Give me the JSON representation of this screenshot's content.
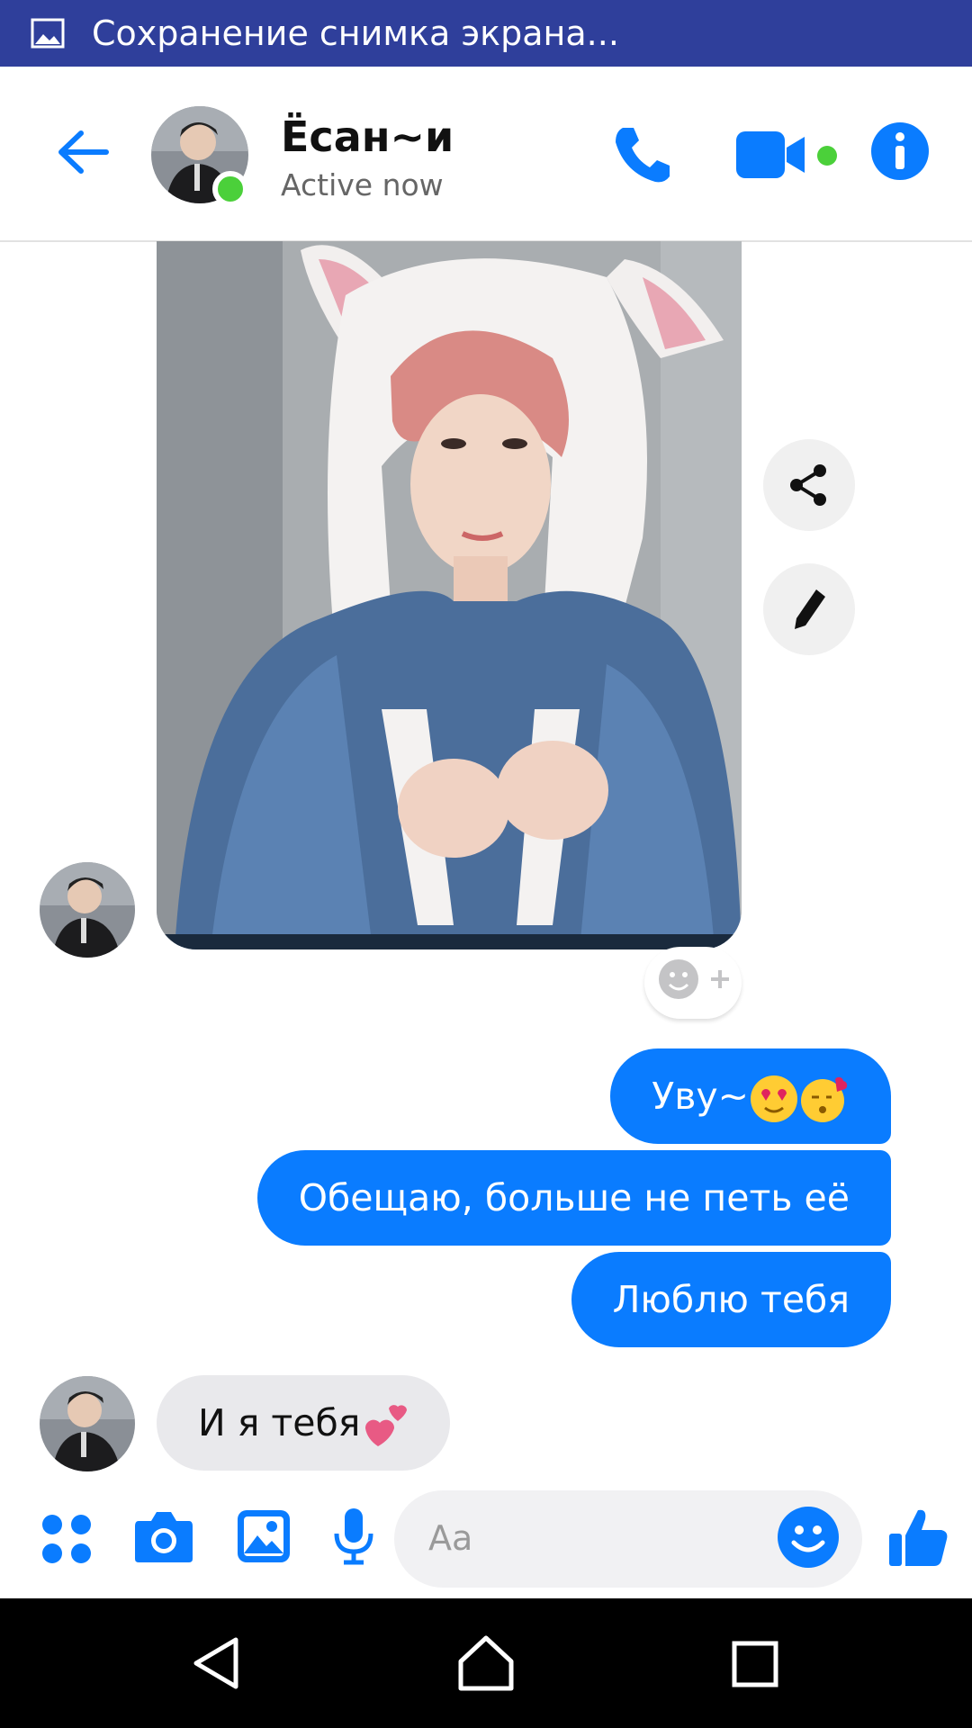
{
  "status_bar": {
    "text": "Сохранение снимка экрана..."
  },
  "header": {
    "contact_name": "Ёсан~и",
    "contact_status": "Active now",
    "icons": [
      "back-arrow-icon",
      "phone-icon",
      "video-camera-icon",
      "info-icon"
    ]
  },
  "conversation": {
    "photo_actions": [
      "share-icon",
      "pencil-icon"
    ],
    "reaction_placeholder_icon": "add-reaction-icon",
    "outgoing": [
      {
        "text": "Уву~",
        "emoji": [
          "heart-eyes-emoji",
          "kissing-emoji"
        ]
      },
      {
        "text": "Обещаю, больше не петь её"
      },
      {
        "text": "Люблю тебя"
      }
    ],
    "incoming": [
      {
        "text": "И я тебя",
        "emoji": [
          "two-hearts-emoji"
        ]
      }
    ]
  },
  "composer": {
    "placeholder": "Aa",
    "icons": [
      "apps-grid-icon",
      "camera-icon",
      "gallery-icon",
      "microphone-icon",
      "emoji-icon",
      "thumbs-up-icon"
    ]
  },
  "colors": {
    "accent": "#0a7cff",
    "status_bar": "#2f3f9b",
    "online": "#4bd03a"
  }
}
